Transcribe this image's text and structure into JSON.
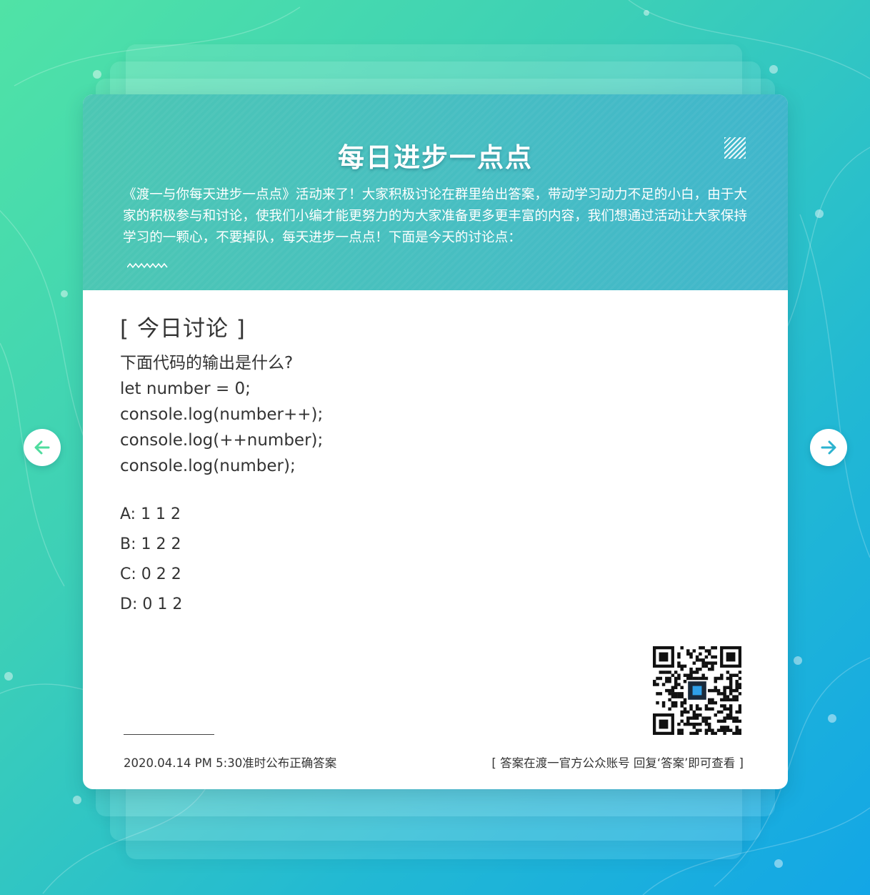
{
  "page": {
    "title": "每日进步一点点",
    "intro": "《渡一与你每天进步一点点》活动来了！大家积极讨论在群里给出答案，带动学习动力不足的小白，由于大家的积极参与和讨论，使我们小编才能更努力的为大家准备更多更丰富的内容，我们想通过活动让大家保持学习的一颗心，不要掉队，每天进步一点点！下面是今天的讨论点："
  },
  "discussion": {
    "heading": "[ 今日讨论 ]",
    "question_lines": [
      "下面代码的输出是什么?",
      "let number = 0;",
      "console.log(number++);",
      "console.log(++number);",
      "console.log(number);"
    ],
    "options": [
      "A: 1 1 2",
      "B: 1 2 2",
      "C: 0 2 2",
      "D: 0 1 2"
    ]
  },
  "footer": {
    "publish_note": "2020.04.14  PM  5:30准时公布正确答案",
    "answer_hint": "[  答案在渡一官方公众账号 回复‘答案’即可查看  ]"
  },
  "icons": {
    "prev": "arrow-left-icon",
    "next": "arrow-right-icon",
    "qr": "qr-code-icon"
  },
  "colors": {
    "arrow_prev": "#4fdc9e",
    "arrow_next": "#2cb3cf",
    "header_bg": "#47bec2",
    "text": "#333333"
  }
}
